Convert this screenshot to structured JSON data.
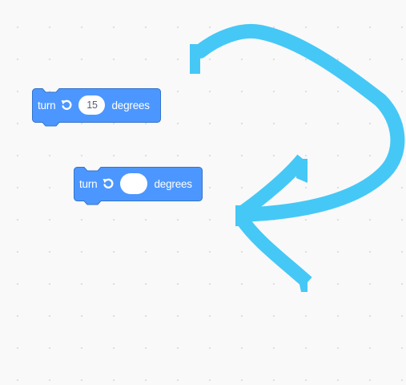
{
  "blocks": [
    {
      "id": "original",
      "label_turn": "turn",
      "icon": "rotate-left-icon",
      "input_value": "15",
      "label_degrees": "degrees",
      "color": "#4C97FF",
      "border_color": "#3373CC"
    },
    {
      "id": "duplicate",
      "label_turn": "turn",
      "icon": "rotate-left-icon",
      "input_value": "",
      "label_degrees": "degrees",
      "color": "#4C97FF",
      "border_color": "#3373CC"
    }
  ],
  "annotation": {
    "icon": "curved-arrow-annotation",
    "color": "#45C8F6"
  }
}
